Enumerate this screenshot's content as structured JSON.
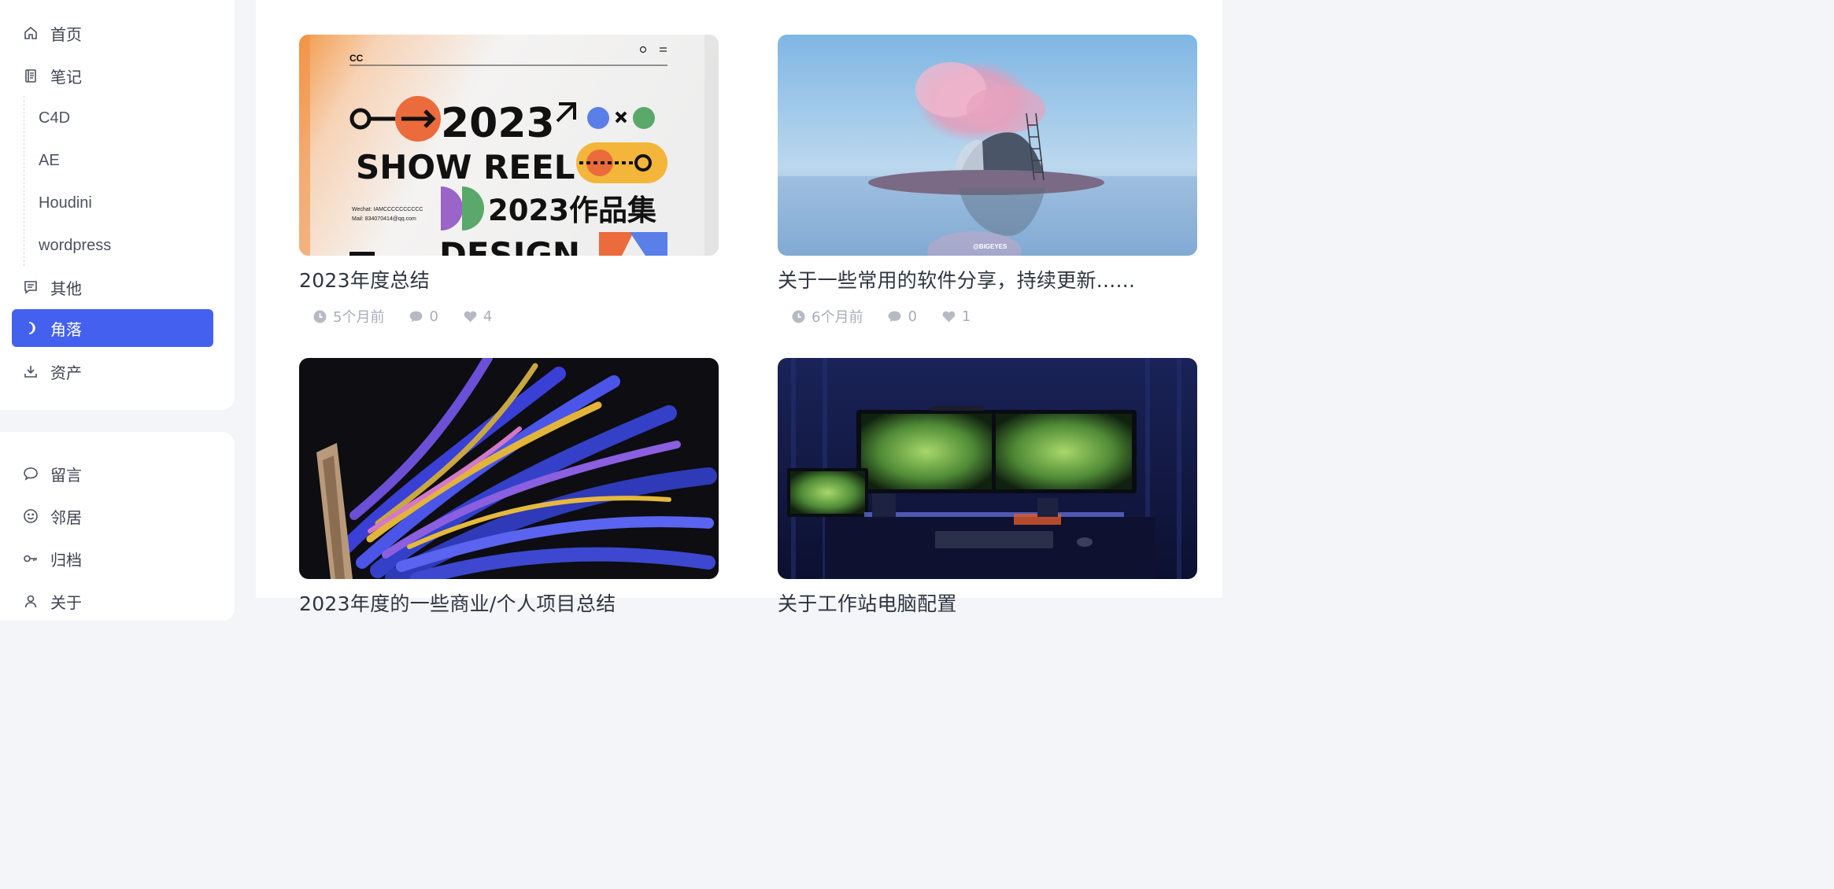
{
  "nav": {
    "primary": [
      {
        "label": "首页",
        "icon": "home-icon"
      },
      {
        "label": "笔记",
        "icon": "notebook-icon"
      },
      {
        "label": "其他",
        "icon": "message-icon"
      },
      {
        "label": "角落",
        "icon": "moon-icon"
      },
      {
        "label": "资产",
        "icon": "download-icon"
      }
    ],
    "sub": [
      "C4D",
      "AE",
      "Houdini",
      "wordpress"
    ],
    "secondary": [
      {
        "label": "留言",
        "icon": "chat-bubble-icon"
      },
      {
        "label": "邻居",
        "icon": "smile-icon"
      },
      {
        "label": "归档",
        "icon": "key-icon"
      },
      {
        "label": "关于",
        "icon": "user-icon"
      }
    ],
    "active_color": "#4361ee"
  },
  "posts": [
    {
      "title": "2023年度总结",
      "time": "5个月前",
      "comments": "0",
      "likes": "4",
      "thumb": {
        "header_logo": "CC",
        "year": "2023",
        "headline": "SHOW REEL",
        "subtitle": "2023作品集",
        "footer_word": "DESIGN",
        "contact_1": "Wechat: IAMCCCCCCCCCC",
        "contact_2": "Mail: 834070414@qq.com"
      }
    },
    {
      "title": "关于一些常用的软件分享，持续更新......",
      "time": "6个月前",
      "comments": "0",
      "likes": "1",
      "thumb": {
        "watermark": "@BIGEYES"
      }
    },
    {
      "title": "2023年度的一些商业/个人项目总结",
      "thumb": {}
    },
    {
      "title": "关于工作站电脑配置",
      "thumb": {}
    }
  ]
}
